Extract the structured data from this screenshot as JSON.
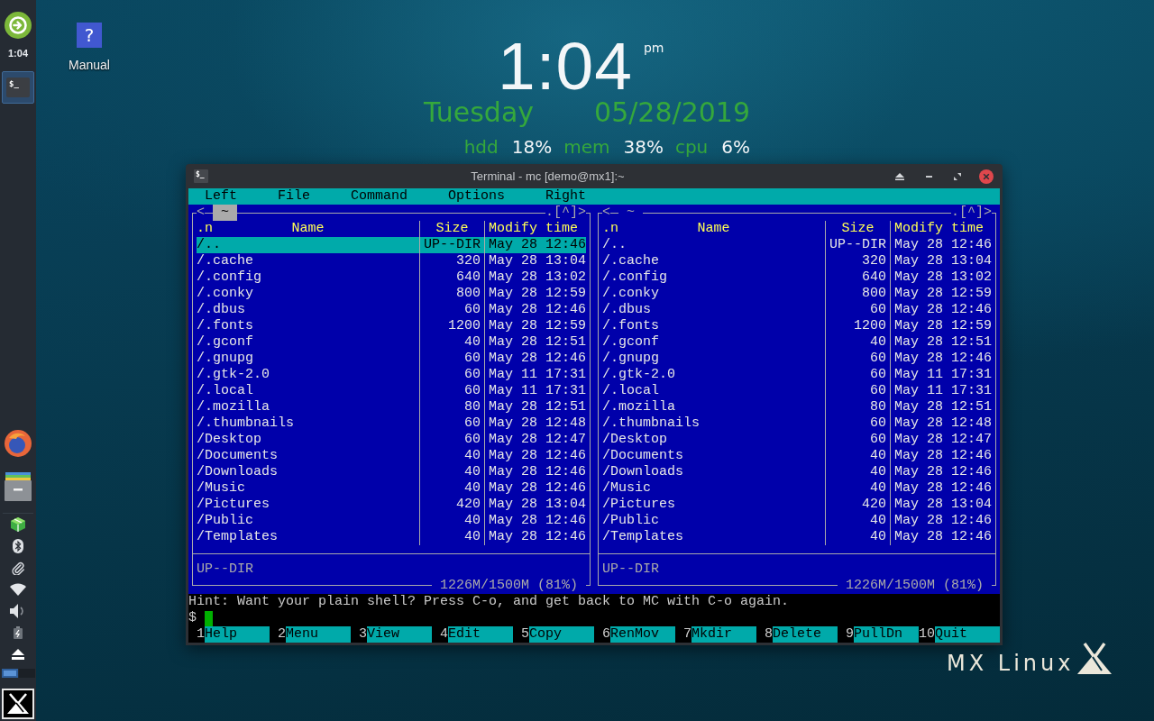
{
  "taskbar": {
    "clock": "1:04",
    "tasks": [
      {
        "icon_text": "$_",
        "selected": true
      }
    ],
    "workspaces": [
      {
        "selected": true
      },
      {
        "selected": false
      }
    ]
  },
  "desktop_icons": [
    {
      "glyph": "?",
      "label": "Manual"
    }
  ],
  "conky": {
    "time": "1:04",
    "meridiem": "pm",
    "day": "Tuesday",
    "date": "05/28/2019",
    "stats": [
      {
        "label": "hdd",
        "value": "18%"
      },
      {
        "label": "mem",
        "value": "38%"
      },
      {
        "label": "cpu",
        "value": "6%"
      }
    ]
  },
  "terminal": {
    "icon_text": "$_",
    "title": "Terminal - mc [demo@mx1]:~",
    "menu": [
      "Left",
      "File",
      "Command",
      "Options",
      "Right"
    ],
    "panels": [
      {
        "active": true,
        "nav_left": "<",
        "path": "~",
        "nav_right": ".[^]>",
        "columns": [
          ".n",
          "Name",
          "Size",
          "Modify time"
        ],
        "rows": [
          {
            "name": "/..",
            "size": "UP--DIR",
            "modify_time": "May 28 12:46",
            "selected": true
          },
          {
            "name": "/.cache",
            "size": "320",
            "modify_time": "May 28 13:04",
            "selected": false
          },
          {
            "name": "/.config",
            "size": "640",
            "modify_time": "May 28 13:02",
            "selected": false
          },
          {
            "name": "/.conky",
            "size": "800",
            "modify_time": "May 28 12:59",
            "selected": false
          },
          {
            "name": "/.dbus",
            "size": "60",
            "modify_time": "May 28 12:46",
            "selected": false
          },
          {
            "name": "/.fonts",
            "size": "1200",
            "modify_time": "May 28 12:59",
            "selected": false
          },
          {
            "name": "/.gconf",
            "size": "40",
            "modify_time": "May 28 12:51",
            "selected": false
          },
          {
            "name": "/.gnupg",
            "size": "60",
            "modify_time": "May 28 12:46",
            "selected": false
          },
          {
            "name": "/.gtk-2.0",
            "size": "60",
            "modify_time": "May 11 17:31",
            "selected": false
          },
          {
            "name": "/.local",
            "size": "60",
            "modify_time": "May 11 17:31",
            "selected": false
          },
          {
            "name": "/.mozilla",
            "size": "80",
            "modify_time": "May 28 12:51",
            "selected": false
          },
          {
            "name": "/.thumbnails",
            "size": "60",
            "modify_time": "May 28 12:48",
            "selected": false
          },
          {
            "name": "/Desktop",
            "size": "60",
            "modify_time": "May 28 12:47",
            "selected": false
          },
          {
            "name": "/Documents",
            "size": "40",
            "modify_time": "May 28 12:46",
            "selected": false
          },
          {
            "name": "/Downloads",
            "size": "40",
            "modify_time": "May 28 12:46",
            "selected": false
          },
          {
            "name": "/Music",
            "size": "40",
            "modify_time": "May 28 12:46",
            "selected": false
          },
          {
            "name": "/Pictures",
            "size": "420",
            "modify_time": "May 28 13:04",
            "selected": false
          },
          {
            "name": "/Public",
            "size": "40",
            "modify_time": "May 28 12:46",
            "selected": false
          },
          {
            "name": "/Templates",
            "size": "40",
            "modify_time": "May 28 12:46",
            "selected": false
          }
        ],
        "status": "UP--DIR",
        "free_space": "1226M/1500M (81%)"
      },
      {
        "active": false,
        "nav_left": "<",
        "path": "~",
        "nav_right": ".[^]>",
        "columns": [
          ".n",
          "Name",
          "Size",
          "Modify time"
        ],
        "rows": [
          {
            "name": "/..",
            "size": "UP--DIR",
            "modify_time": "May 28 12:46",
            "selected": false
          },
          {
            "name": "/.cache",
            "size": "320",
            "modify_time": "May 28 13:04",
            "selected": false
          },
          {
            "name": "/.config",
            "size": "640",
            "modify_time": "May 28 13:02",
            "selected": false
          },
          {
            "name": "/.conky",
            "size": "800",
            "modify_time": "May 28 12:59",
            "selected": false
          },
          {
            "name": "/.dbus",
            "size": "60",
            "modify_time": "May 28 12:46",
            "selected": false
          },
          {
            "name": "/.fonts",
            "size": "1200",
            "modify_time": "May 28 12:59",
            "selected": false
          },
          {
            "name": "/.gconf",
            "size": "40",
            "modify_time": "May 28 12:51",
            "selected": false
          },
          {
            "name": "/.gnupg",
            "size": "60",
            "modify_time": "May 28 12:46",
            "selected": false
          },
          {
            "name": "/.gtk-2.0",
            "size": "60",
            "modify_time": "May 11 17:31",
            "selected": false
          },
          {
            "name": "/.local",
            "size": "60",
            "modify_time": "May 11 17:31",
            "selected": false
          },
          {
            "name": "/.mozilla",
            "size": "80",
            "modify_time": "May 28 12:51",
            "selected": false
          },
          {
            "name": "/.thumbnails",
            "size": "60",
            "modify_time": "May 28 12:48",
            "selected": false
          },
          {
            "name": "/Desktop",
            "size": "60",
            "modify_time": "May 28 12:47",
            "selected": false
          },
          {
            "name": "/Documents",
            "size": "40",
            "modify_time": "May 28 12:46",
            "selected": false
          },
          {
            "name": "/Downloads",
            "size": "40",
            "modify_time": "May 28 12:46",
            "selected": false
          },
          {
            "name": "/Music",
            "size": "40",
            "modify_time": "May 28 12:46",
            "selected": false
          },
          {
            "name": "/Pictures",
            "size": "420",
            "modify_time": "May 28 13:04",
            "selected": false
          },
          {
            "name": "/Public",
            "size": "40",
            "modify_time": "May 28 12:46",
            "selected": false
          },
          {
            "name": "/Templates",
            "size": "40",
            "modify_time": "May 28 12:46",
            "selected": false
          }
        ],
        "status": "UP--DIR",
        "free_space": "1226M/1500M (81%)"
      }
    ],
    "hint": "Hint: Want your plain shell? Press C-o, and get back to MC with C-o again.",
    "prompt": "$",
    "function_keys": [
      {
        "number": "1",
        "label": "Help"
      },
      {
        "number": "2",
        "label": "Menu"
      },
      {
        "number": "3",
        "label": "View"
      },
      {
        "number": "4",
        "label": "Edit"
      },
      {
        "number": "5",
        "label": "Copy"
      },
      {
        "number": "6",
        "label": "RenMov"
      },
      {
        "number": "7",
        "label": "Mkdir"
      },
      {
        "number": "8",
        "label": "Delete"
      },
      {
        "number": "9",
        "label": "PullDn"
      },
      {
        "number": "10",
        "label": "Quit"
      }
    ]
  },
  "branding": {
    "text": "MX Linux"
  }
}
